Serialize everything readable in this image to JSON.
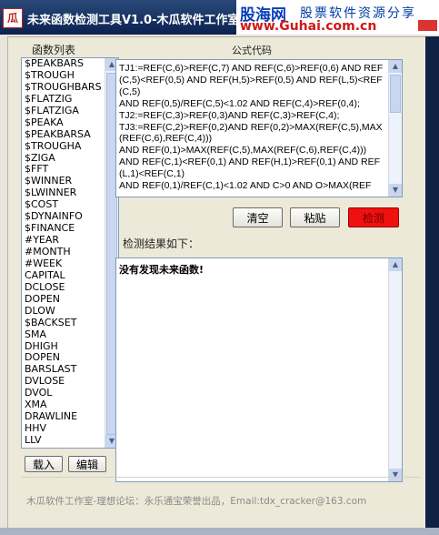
{
  "window": {
    "title": "未来函数检测工具V1.0-木瓜软件工作室",
    "icon_text": "瓜"
  },
  "watermark": {
    "logo": "股海网",
    "slogan": "股票软件资源分享",
    "url": "www.Guhai.com.cn"
  },
  "function_list": {
    "label": "函数列表",
    "items": [
      "$PEAKBARS",
      "$TROUGH",
      "$TROUGHBARS",
      "$FLATZIG",
      "$FLATZIGA",
      "$PEAKA",
      "$PEAKBARSA",
      "$TROUGHA",
      "$ZIGA",
      "$FFT",
      "$WINNER",
      "$LWINNER",
      "$COST",
      "$DYNAINFO",
      "$FINANCE",
      "#YEAR",
      "#MONTH",
      "#WEEK",
      "CAPITAL",
      "DCLOSE",
      "DOPEN",
      "DLOW",
      "$BACKSET",
      "SMA",
      "DHIGH",
      "DOPEN",
      "BARSLAST",
      "DVLOSE",
      "DVOL",
      "XMA",
      "DRAWLINE",
      "HHV",
      "LLV"
    ]
  },
  "formula": {
    "label": "公式代码",
    "code": "TJ1:=REF(C,6)>REF(C,7) AND REF(C,6)>REF(0,6) AND REF(C,5)<REF(0,5) AND REF(H,5)>REF(0,5) AND REF(L,5)<REF(C,5)\nAND REF(0,5)/REF(C,5)<1.02 AND REF(C,4)>REF(0,4);\nTJ2:=REF(C,3)>REF(0,3)AND REF(C,3)>REF(C,4);\nTJ3:=REF(C,2)>REF(0,2)AND REF(0,2)>MAX(REF(C,5),MAX(REF(C,6),REF(C,4)))\nAND REF(0,1)>MAX(REF(C,5),MAX(REF(C,6),REF(C,4)))\nAND REF(C,1)<REF(0,1) AND REF(H,1)>REF(0,1) AND REF(L,1)<REF(C,1)\nAND REF(0,1)/REF(C,1)<1.02 AND C>0 AND O>MAX(REF"
  },
  "buttons": {
    "clear": "清空",
    "paste": "粘贴",
    "detect": "检测",
    "load": "载入",
    "edit": "编辑"
  },
  "results": {
    "label": "检测结果如下：",
    "text": "没有发现未来函数!"
  },
  "footer": {
    "text": "木瓜软件工作室-理想论坛：永乐通宝荣誉出品，Email:tdx_cracker@163.com"
  }
}
